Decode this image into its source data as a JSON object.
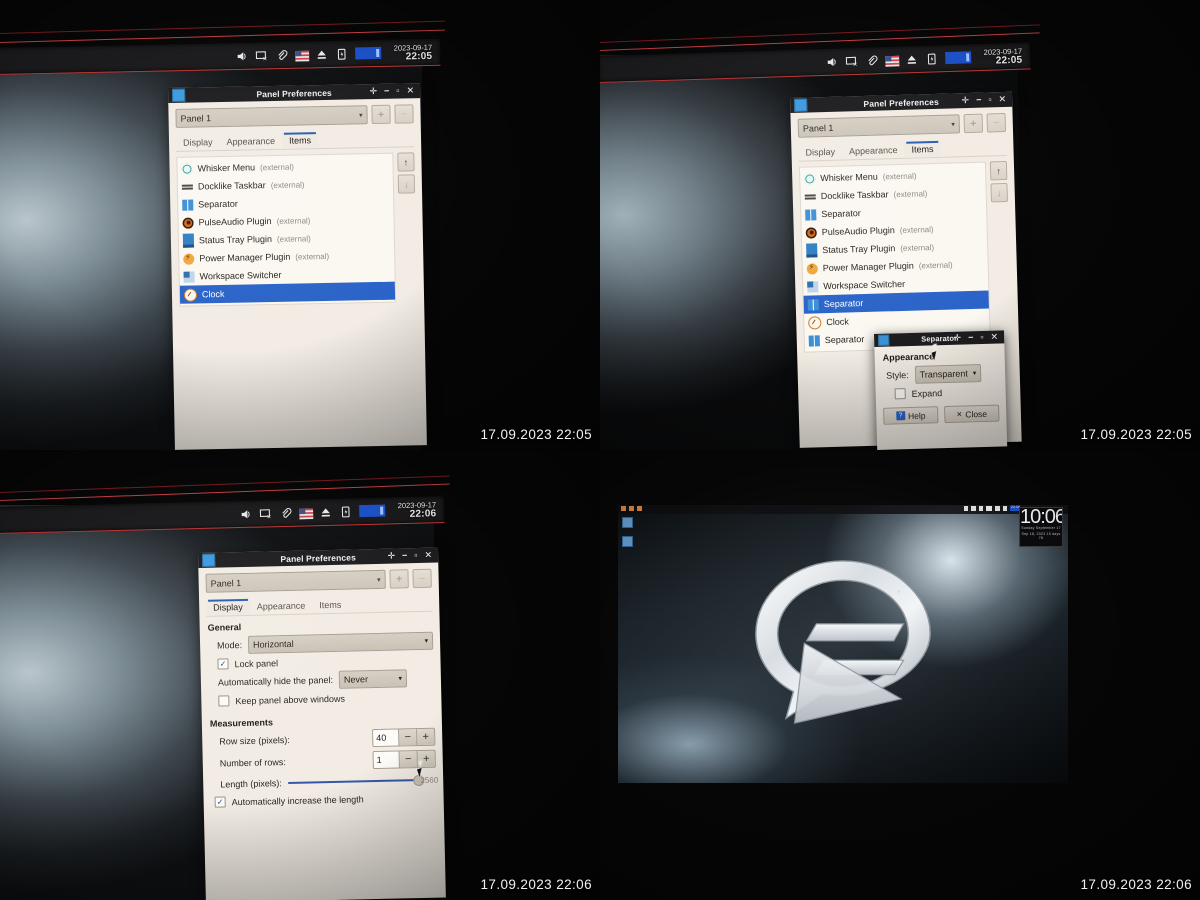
{
  "meta": {
    "description": "Four photos of a monitor showing XFCE Panel Preferences",
    "accent_blue": "#2a63c8",
    "panel_bg": "#19191b",
    "dialog_bg": "#f2ece4",
    "red_edge": "#e0474d"
  },
  "quadrants": [
    {
      "id": "q1",
      "stamp": "17.09.2023 22:05"
    },
    {
      "id": "q2",
      "stamp": "17.09.2023 22:05"
    },
    {
      "id": "q3",
      "stamp": "17.09.2023 22:06"
    },
    {
      "id": "q4",
      "stamp": "17.09.2023 22:06"
    }
  ],
  "xfce_panel": {
    "icons": [
      "volume-icon",
      "display-off-icon",
      "clipboard-icon",
      "keyboard-layout-flag-icon",
      "eject-icon",
      "battery-icon"
    ],
    "date_q1": "2023-09-17",
    "time_q1": "22:05",
    "date_q3": "2023-09-17",
    "time_q3": "22:06"
  },
  "window": {
    "title": "Panel Preferences",
    "app_icon": "panel-icon",
    "controls": {
      "stick": "✛",
      "minimize": "−",
      "maximize": "▫",
      "close": "✕"
    },
    "panel_select": {
      "value": "Panel 1",
      "arrow": "▾"
    },
    "add_button": "+",
    "remove_button": "−",
    "tabs": [
      {
        "label": "Display"
      },
      {
        "label": "Appearance"
      },
      {
        "label": "Items"
      }
    ]
  },
  "items_tab": {
    "active_tab": "Items",
    "move_up": "↑",
    "move_down": "↓",
    "list_q1": [
      {
        "label": "Whisker Menu",
        "suffix": "(external)",
        "icon": "ic-whisker",
        "selected": false
      },
      {
        "label": "Docklike Taskbar",
        "suffix": "(external)",
        "icon": "ic-dock",
        "selected": false
      },
      {
        "label": "Separator",
        "suffix": "",
        "icon": "ic-sep",
        "selected": false
      },
      {
        "label": "PulseAudio Plugin",
        "suffix": "(external)",
        "icon": "ic-pulse",
        "selected": false
      },
      {
        "label": "Status Tray Plugin",
        "suffix": "(external)",
        "icon": "ic-tray",
        "selected": false
      },
      {
        "label": "Power Manager Plugin",
        "suffix": "(external)",
        "icon": "ic-power",
        "selected": false
      },
      {
        "label": "Workspace Switcher",
        "suffix": "",
        "icon": "ic-wsw",
        "selected": false
      },
      {
        "label": "Clock",
        "suffix": "",
        "icon": "ic-clock",
        "selected": true
      }
    ],
    "list_q2": [
      {
        "label": "Whisker Menu",
        "suffix": "(external)",
        "icon": "ic-whisker",
        "selected": false
      },
      {
        "label": "Docklike Taskbar",
        "suffix": "(external)",
        "icon": "ic-dock",
        "selected": false
      },
      {
        "label": "Separator",
        "suffix": "",
        "icon": "ic-sep",
        "selected": false
      },
      {
        "label": "PulseAudio Plugin",
        "suffix": "(external)",
        "icon": "ic-pulse",
        "selected": false
      },
      {
        "label": "Status Tray Plugin",
        "suffix": "(external)",
        "icon": "ic-tray",
        "selected": false
      },
      {
        "label": "Power Manager Plugin",
        "suffix": "(external)",
        "icon": "ic-power",
        "selected": false
      },
      {
        "label": "Workspace Switcher",
        "suffix": "",
        "icon": "ic-wsw",
        "selected": false
      },
      {
        "label": "Separator",
        "suffix": "",
        "icon": "ic-sep",
        "selected": true
      },
      {
        "label": "Clock",
        "suffix": "",
        "icon": "ic-clock",
        "selected": false
      },
      {
        "label": "Separator",
        "suffix": "",
        "icon": "ic-sep",
        "selected": false
      }
    ]
  },
  "separator_dialog": {
    "title": "Separator",
    "icon": "ic-sep",
    "section": "Appearance",
    "style_label": "Style:",
    "style_value": "Transparent",
    "style_arrow": "▾",
    "expand_label": "Expand",
    "expand_checked": false,
    "help_button": "Help",
    "help_icon": "?",
    "close_button": "Close",
    "close_icon": "✕"
  },
  "display_tab": {
    "active_tab": "Display",
    "general_heading": "General",
    "mode_label": "Mode:",
    "mode_value": "Horizontal",
    "lock_panel_label": "Lock panel",
    "lock_panel_checked": true,
    "autohide_label": "Automatically hide the panel:",
    "autohide_value": "Never",
    "keep_above_label": "Keep panel above windows",
    "keep_above_checked": false,
    "measurements_heading": "Measurements",
    "row_size_label": "Row size (pixels):",
    "row_size_value": "40",
    "rows_label": "Number of rows:",
    "rows_value": "1",
    "length_label": "Length (pixels):",
    "length_value": "2560",
    "auto_length_label": "Automatically increase the length",
    "auto_length_checked": true,
    "minus": "−",
    "plus": "+"
  },
  "desktop": {
    "conky_time": "10:06",
    "conky_date": "Sunday   September 17",
    "conky_sub": "Sep 18, 2023   15 days   78",
    "wallpaper": "3d-q-arrow-logo",
    "tray_time": "22:06"
  }
}
